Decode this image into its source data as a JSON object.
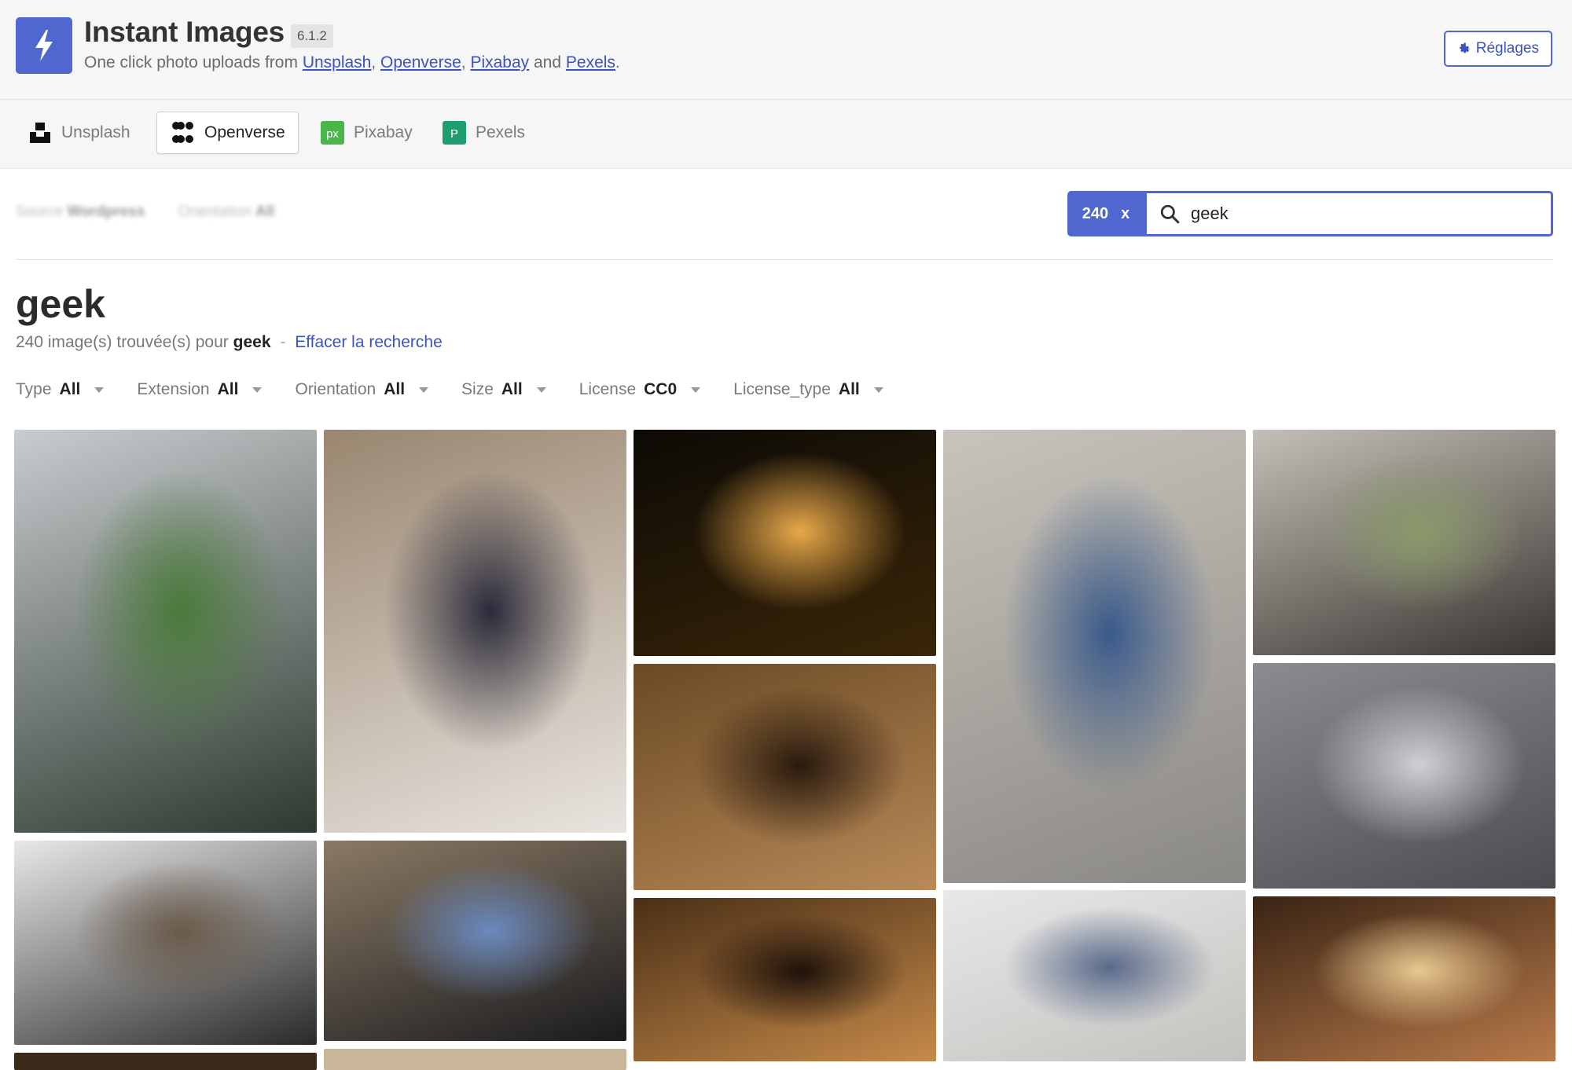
{
  "header": {
    "title": "Instant Images",
    "version": "6.1.2",
    "tagline_prefix": "One click photo uploads from ",
    "links": [
      "Unsplash",
      "Openverse",
      "Pixabay",
      "Pexels"
    ],
    "sep_comma": ", ",
    "sep_and": " and ",
    "tagline_end": ".",
    "settings_label": "Réglages"
  },
  "tabs": [
    {
      "label": "Unsplash",
      "icon": "unsplash-icon"
    },
    {
      "label": "Openverse",
      "icon": "openverse-icon"
    },
    {
      "label": "Pixabay",
      "icon": "pixabay-icon"
    },
    {
      "label": "Pexels",
      "icon": "pexels-icon"
    }
  ],
  "blurred_filters": {
    "source_label": "Source",
    "source_value": "Wordpress",
    "orientation_label": "Orientation",
    "orientation_value": "All"
  },
  "search": {
    "count": "240",
    "clear_symbol": "x",
    "value": "geek"
  },
  "results": {
    "heading": "geek",
    "summary_prefix": "240 image(s) trouvée(s) pour",
    "term": "geek",
    "dash": "-",
    "clear_label": "Effacer la recherche"
  },
  "filters": [
    {
      "label": "Type",
      "value": "All"
    },
    {
      "label": "Extension",
      "value": "All"
    },
    {
      "label": "Orientation",
      "value": "All"
    },
    {
      "label": "Size",
      "value": "All"
    },
    {
      "label": "License",
      "value": "CC0"
    },
    {
      "label": "License_type",
      "value": "All"
    }
  ],
  "photos": [
    {
      "name": "vr-headset-geek-photo",
      "colors": [
        "#c9ccd0",
        "#2c3a2f",
        "#4a7a3a"
      ]
    },
    {
      "name": "geeks-bearing-gifts-photo",
      "colors": [
        "#9a8670",
        "#e8e4df",
        "#2b2b3a"
      ]
    },
    {
      "name": "lamps-photo",
      "colors": [
        "#0c0a06",
        "#3a2608",
        "#e8a84a"
      ]
    },
    {
      "name": "man-restaurant-photo",
      "colors": [
        "#6a4a24",
        "#b98a58",
        "#2a1a0e"
      ]
    },
    {
      "name": "man-bearded-restaurant-photo",
      "colors": [
        "#4a3016",
        "#c68a4a",
        "#1e120a"
      ]
    },
    {
      "name": "yoga-stretch-photo",
      "colors": [
        "#c8c4bc",
        "#8a8884",
        "#3a5a8a"
      ]
    },
    {
      "name": "people-meeting-photo",
      "colors": [
        "#e8e8e8",
        "#c4c2be",
        "#5a6a8a"
      ]
    },
    {
      "name": "yoga-class-photo",
      "colors": [
        "#c4c0b8",
        "#3a3430",
        "#8a9a6a"
      ]
    },
    {
      "name": "boutique-window-photo",
      "colors": [
        "#8a8c90",
        "#4a4c50",
        "#d0d0d4"
      ]
    },
    {
      "name": "people-kiss-photo",
      "colors": [
        "#3a2414",
        "#b87a4a",
        "#e8c890"
      ]
    },
    {
      "name": "video-chat-photo",
      "colors": [
        "#e8e8e8",
        "#2a2a2a",
        "#6a5a4a"
      ]
    },
    {
      "name": "iphone-rocks-photo",
      "colors": [
        "#8a7a64",
        "#1a1a1e",
        "#6a8ac0"
      ]
    }
  ]
}
